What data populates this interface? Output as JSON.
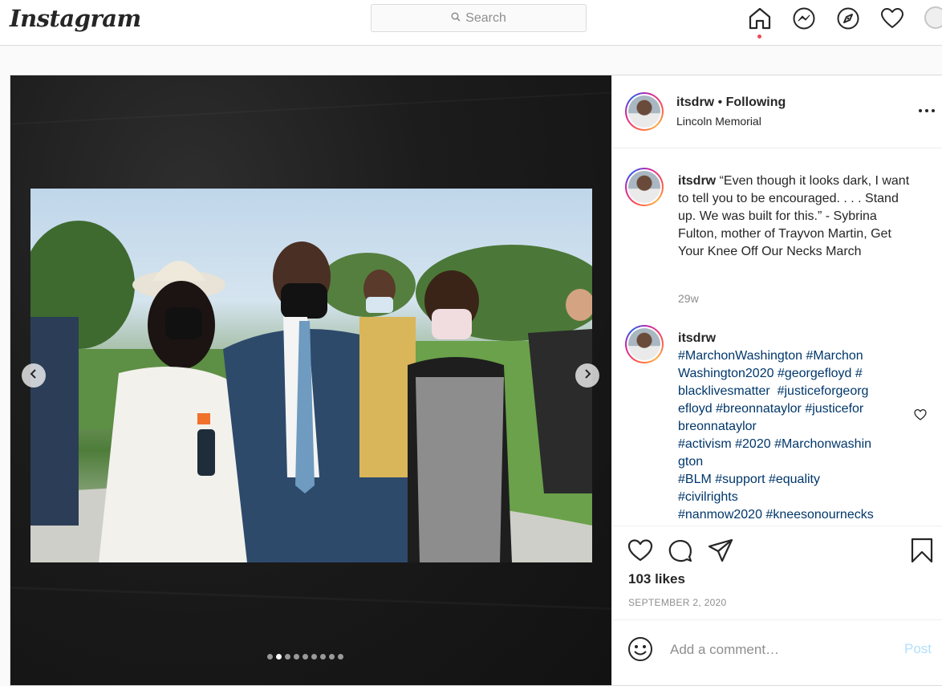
{
  "app": {
    "logo": "Instagram"
  },
  "search": {
    "placeholder": "Search"
  },
  "nav": {
    "icons": [
      "home-icon",
      "messenger-icon",
      "explore-compass-icon",
      "heart-activity-icon",
      "profile-avatar"
    ]
  },
  "post": {
    "username": "itsdrw",
    "separator": " • ",
    "following_label": "Following",
    "location": "Lincoln Memorial",
    "carousel": {
      "current": 2,
      "total": 9
    },
    "comments": [
      {
        "username": "itsdrw",
        "text": "“Even though it looks dark, I want to tell you to be encouraged. . . . Stand up. We was built for this.” - Sybrina Fulton, mother of Trayvon Martin, Get Your Knee Off Our Necks March",
        "time": "29w"
      },
      {
        "username": "itsdrw",
        "hashtags_lines": [
          "#MarchonWashington #Marchon",
          "Washington2020 #georgefloyd #",
          "blacklivesmatter  #justiceforgeorg",
          "efloyd #breonnataylor #justicefor",
          "breonnataylor",
          "#activism #2020 #Marchonwashin",
          "gton",
          "#BLM #support #equality",
          "#civilrights",
          "#nanmow2020 #kneesonournecks"
        ]
      }
    ],
    "likes": "103 likes",
    "date": "SEPTEMBER 2, 2020",
    "add_comment_placeholder": "Add a comment…",
    "post_label": "Post"
  },
  "colors": {
    "link_blue": "#00376b",
    "post_disabled": "#b2dffc",
    "notification_dot": "#ed4956"
  }
}
